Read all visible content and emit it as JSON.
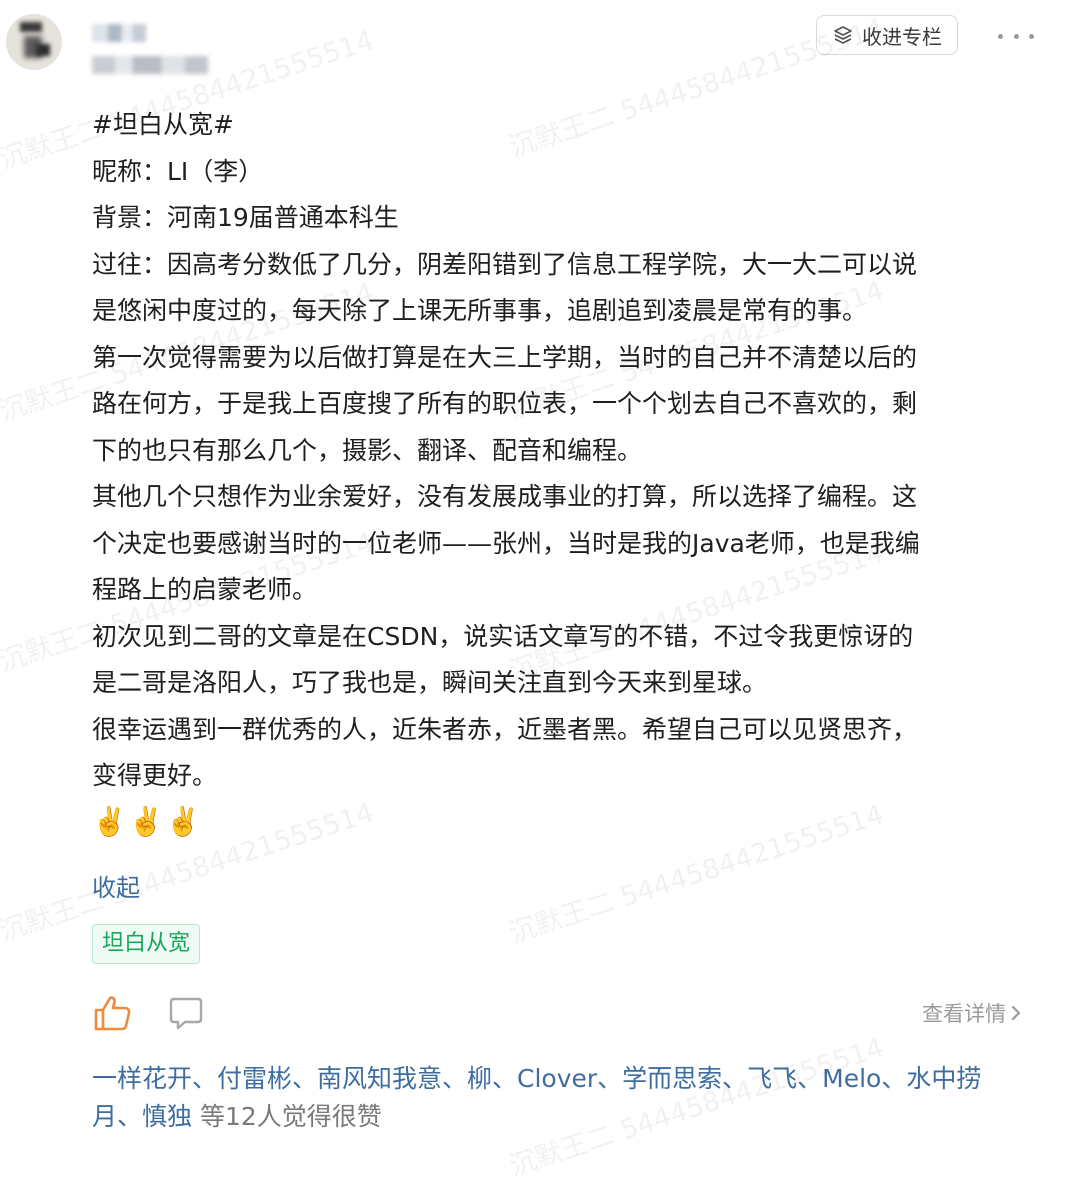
{
  "header": {
    "collect_button_label": "收进专栏",
    "more_icon": "more-dots-icon"
  },
  "post": {
    "lines": [
      "#坦白从宽#",
      "昵称：LI（李）",
      "背景：河南19届普通本科生",
      "过往：因高考分数低了几分，阴差阳错到了信息工程学院，大一大二可以说",
      "是悠闲中度过的，每天除了上课无所事事，追剧追到凌晨是常有的事。",
      "第一次觉得需要为以后做打算是在大三上学期，当时的自己并不清楚以后的",
      "路在何方，于是我上百度搜了所有的职位表，一个个划去自己不喜欢的，剩",
      "下的也只有那么几个，摄影、翻译、配音和编程。",
      "其他几个只想作为业余爱好，没有发展成事业的打算，所以选择了编程。这",
      "个决定也要感谢当时的一位老师——张州，当时是我的Java老师，也是我编",
      "程路上的启蒙老师。",
      "初次见到二哥的文章是在CSDN，说实话文章写的不错，不过令我更惊讶的",
      "是二哥是洛阳人，巧了我也是，瞬间关注直到今天来到星球。",
      "很幸运遇到一群优秀的人，近朱者赤，近墨者黑。希望自己可以见贤思齐，",
      "变得更好。"
    ],
    "emoji": "✌️✌️✌️",
    "collapse_label": "收起",
    "tag": "坦白从宽"
  },
  "actions": {
    "like_icon": "thumbs-up-icon",
    "comment_icon": "comment-icon",
    "detail_label": "查看详情"
  },
  "likes": {
    "names": "一样花开、付雷彬、南风知我意、柳、Clover、学而思索、飞飞、Melo、水中捞月、慎独",
    "suffix": " 等12人觉得很赞"
  },
  "watermark": {
    "text": "沉默王二 5444584421555514"
  },
  "colors": {
    "link": "#3f6da0",
    "tag_green": "#16a85a",
    "like_orange": "#f08a3c",
    "muted": "#9b9b9b"
  }
}
